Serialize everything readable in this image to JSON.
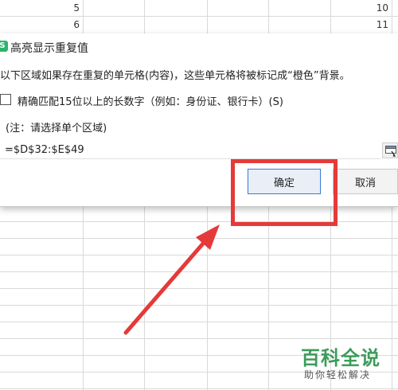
{
  "sheet": {
    "row_values": [
      {
        "value": "5"
      },
      {
        "value": "6"
      }
    ],
    "right_values": [
      {
        "value": "10"
      },
      {
        "value": "11"
      }
    ]
  },
  "dialog": {
    "title": "高亮显示重复值",
    "description": "以下区域如果存在重复的单元格(内容)，这些单元格将被标记成“橙色”背景。",
    "exact_match_label": "精确匹配15位以上的长数字（例如：身份证、银行卡）(S)",
    "exact_match_checked": false,
    "note": "(注：请选择单个区域)",
    "range_value": "=$D$32:$E$49",
    "ok_label": "确定",
    "cancel_label": "取消"
  },
  "annotation": {
    "color": "#e53a3a"
  },
  "watermark": {
    "logo": "百科全说",
    "tagline": "助你轻松解决"
  }
}
